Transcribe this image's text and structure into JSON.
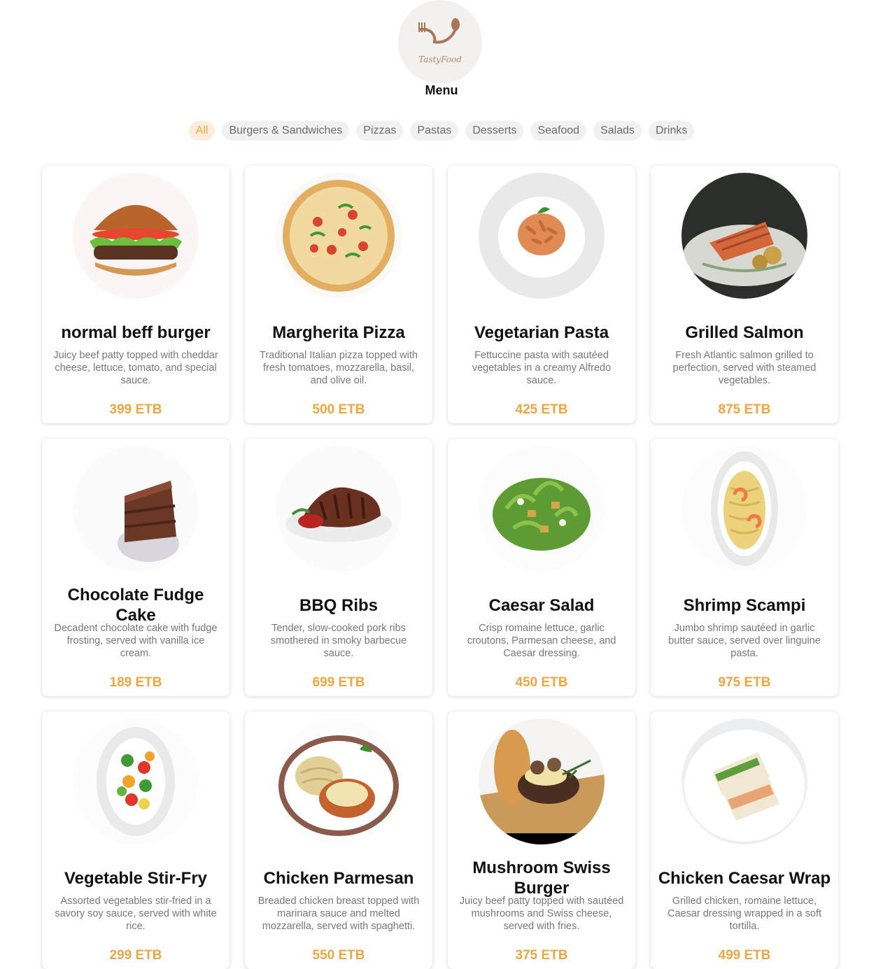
{
  "brand": {
    "logo_text": "TastyFood",
    "title": "Menu"
  },
  "tabs": [
    {
      "label": "All",
      "active": true
    },
    {
      "label": "Burgers & Sandwiches"
    },
    {
      "label": "Pizzas"
    },
    {
      "label": "Pastas"
    },
    {
      "label": "Desserts"
    },
    {
      "label": "Seafood"
    },
    {
      "label": "Salads"
    },
    {
      "label": "Drinks"
    }
  ],
  "items": [
    {
      "name": "normal beff burger",
      "description": "Juicy beef patty topped with cheddar cheese, lettuce, tomato, and special sauce.",
      "price": "399 ETB",
      "icon": "burger-icon"
    },
    {
      "name": "Margherita Pizza",
      "description": "Traditional Italian pizza topped with fresh tomatoes, mozzarella, basil, and olive oil.",
      "price": "500 ETB",
      "icon": "pizza-icon"
    },
    {
      "name": "Vegetarian Pasta",
      "description": "Fettuccine pasta with sautéed vegetables in a creamy Alfredo sauce.",
      "price": "425 ETB",
      "icon": "pasta-bowl-icon"
    },
    {
      "name": "Grilled Salmon",
      "description": "Fresh Atlantic salmon grilled to perfection, served with steamed vegetables.",
      "price": "875 ETB",
      "icon": "salmon-plate-icon"
    },
    {
      "name": "Chocolate Fudge Cake",
      "description": "Decadent chocolate cake with fudge frosting, served with vanilla ice cream.",
      "price": "189 ETB",
      "icon": "cake-slice-icon"
    },
    {
      "name": "BBQ Ribs",
      "description": "Tender, slow-cooked pork ribs smothered in smoky barbecue sauce.",
      "price": "699 ETB",
      "icon": "ribs-plate-icon"
    },
    {
      "name": "Caesar Salad",
      "description": "Crisp romaine lettuce, garlic croutons, Parmesan cheese, and Caesar dressing.",
      "price": "450 ETB",
      "icon": "salad-bowl-icon"
    },
    {
      "name": "Shrimp Scampi",
      "description": "Jumbo shrimp sautéed in garlic butter sauce, served over linguine pasta.",
      "price": "975 ETB",
      "icon": "shrimp-pasta-icon"
    },
    {
      "name": "Vegetable Stir-Fry",
      "description": "Assorted vegetables stir-fried in a savory soy sauce, served with white rice.",
      "price": "299 ETB",
      "icon": "stir-fry-icon"
    },
    {
      "name": "Chicken Parmesan",
      "description": "Breaded chicken breast topped with marinara sauce and melted mozzarella, served with spaghetti.",
      "price": "550 ETB",
      "icon": "chicken-parmesan-icon"
    },
    {
      "name": "Mushroom Swiss Burger",
      "description": "Juicy beef patty topped with sautéed mushrooms and Swiss cheese, served with fries.",
      "price": "375 ETB",
      "icon": "mushroom-burger-icon"
    },
    {
      "name": "Chicken Caesar Wrap",
      "description": "Grilled chicken, romaine lettuce, Caesar dressing wrapped in a soft tortilla.",
      "price": "499 ETB",
      "icon": "wrap-icon"
    }
  ],
  "colors": {
    "accent": "#f0a640",
    "tab_bg": "#f1f1f1",
    "tab_active_bg": "#fdeedb"
  }
}
